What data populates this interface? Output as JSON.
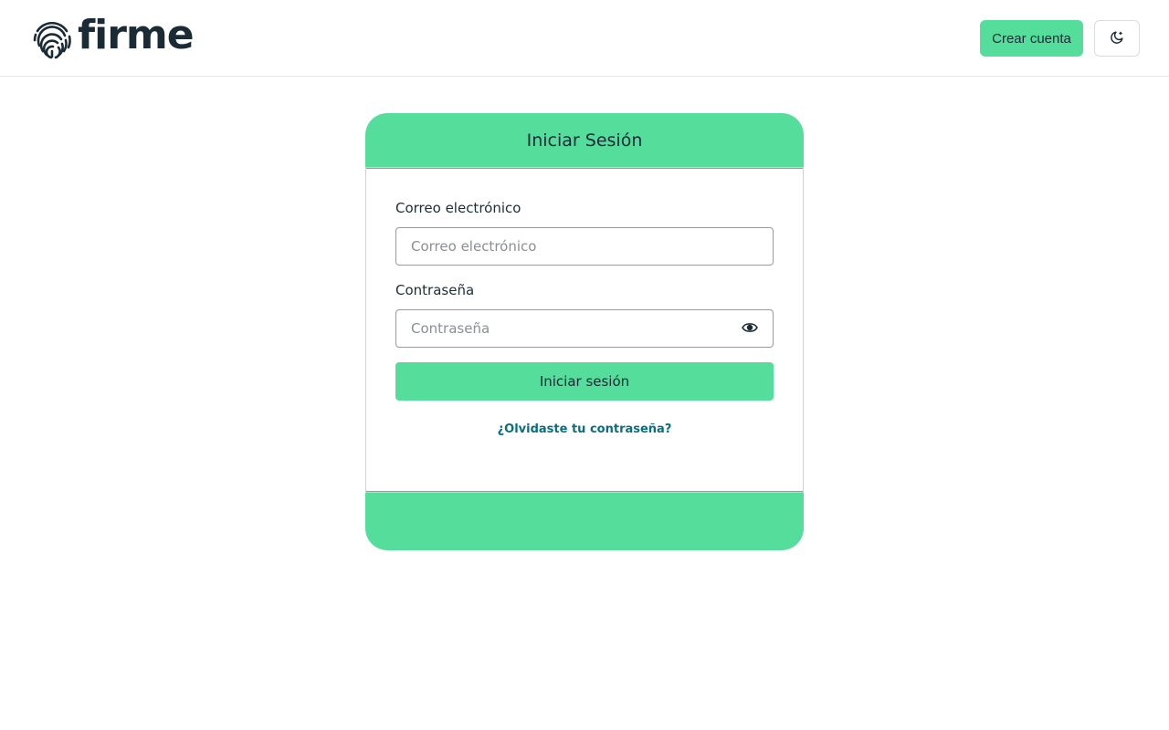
{
  "brand": {
    "name": "firme",
    "logo_icon": "fingerprint-icon",
    "color": "#1a2b36"
  },
  "header": {
    "create_account_label": "Crear cuenta",
    "theme_toggle_icon": "moon-icon"
  },
  "login_card": {
    "title": "Iniciar Sesión",
    "email": {
      "label": "Correo electrónico",
      "placeholder": "Correo electrónico",
      "value": ""
    },
    "password": {
      "label": "Contraseña",
      "placeholder": "Contraseña",
      "value": "",
      "toggle_icon": "eye-icon"
    },
    "submit_label": "Iniciar sesión",
    "forgot_link": "¿Olvidaste tu contraseña?"
  },
  "colors": {
    "accent": "#54dd9b",
    "link": "#0b6e80",
    "text": "#1d2d35"
  }
}
